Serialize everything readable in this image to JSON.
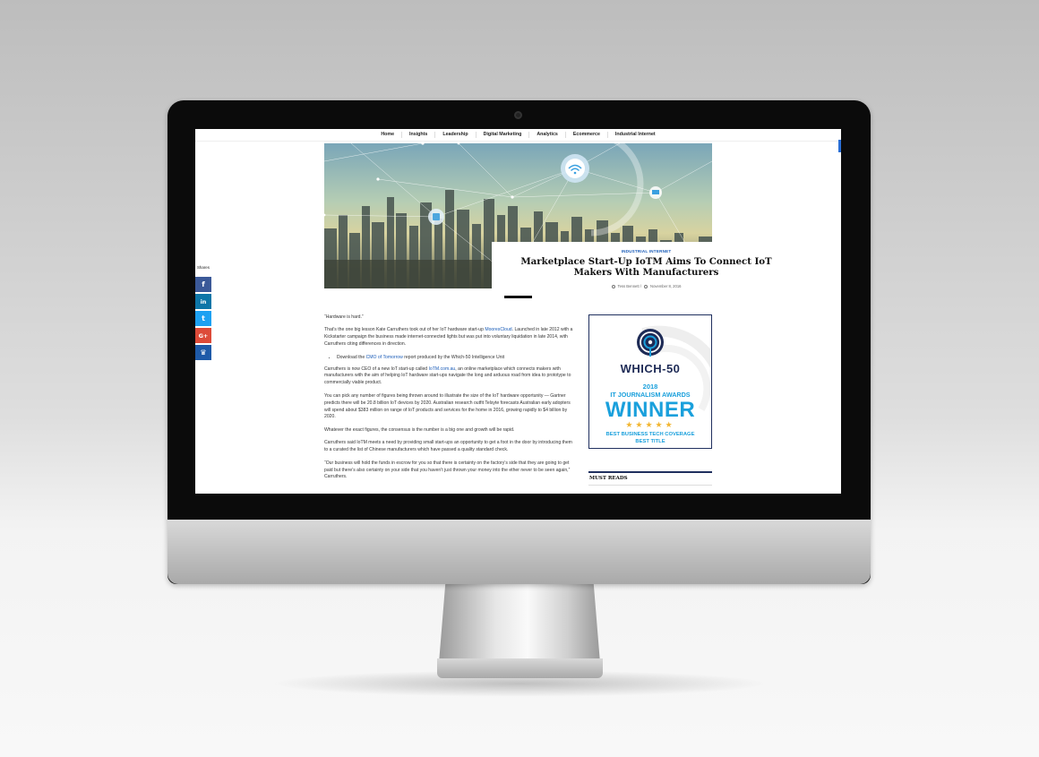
{
  "nav": {
    "items": [
      "Home",
      "Insights",
      "Leadership",
      "Digital Marketing",
      "Analytics",
      "Ecommerce",
      "Industrial Internet"
    ]
  },
  "article": {
    "category": "INDUSTRIAL INTERNET",
    "title": "Marketplace Start-Up IoTM Aims To Connect IoT Makers With Manufacturers",
    "author": "Tess Bennett /",
    "date": "November 8, 2016",
    "p1": "“Hardware is hard.”",
    "p2_before": "That’s the one big lesson Kate Carruthers took out of her IoT hardware start-up ",
    "p2_link": "MooresCloud",
    "p2_after": ". Launched in late 2012 with a Kickstarter campaign the business made internet-connected lights but was put into voluntary liquidation in late 2014, with Carruthers citing differences in direction.",
    "bullet_before": "Download the ",
    "bullet_link": "CMO of Tomorrow",
    "bullet_after": " report produced by the Which-50 Intelligence Unit",
    "p3_before": "Carruthers is now CEO of a new IoT start-up called ",
    "p3_link": "IoTM.com.au",
    "p3_after": ", an online marketplace which connects makers with manufacturers with the aim of helping IoT hardware start-ups navigate the long and arduous road from idea to prototype to commercially viable product.",
    "p4": "You can pick any number of figures being thrown around to illustrate the size of the IoT hardware opportunity — Gartner predicts there will be 20.8 billion IoT devices by 2020. Australian research outfit Telsyte forecasts Australian early adopters will spend about $383 million on range of IoT products and services for the home in 2016, growing rapidly to $4 billion by 2020.",
    "p5": "Whatever the exact figures, the consensus is the number is a big one and growth will be rapid.",
    "p6": "Carruthers said IoTM meets a need by providing small start-ups an opportunity to get a foot in the door by introducing them to a curated the list of Chinese manufacturers which have passed a quality standard check.",
    "p7": "“Our business will hold the funds in escrow for you so that there is certainty on the factory’s side that they are going to get paid but there’s also certainty on your side that you haven’t just thrown your money into the ether never to be seen again,” Carruthers."
  },
  "share": {
    "label": "Shares",
    "buttons": [
      {
        "glyph": "f",
        "icon": "facebook-icon",
        "color": "#3b5998"
      },
      {
        "glyph": "in",
        "icon": "linkedin-icon",
        "color": "#0e76a8"
      },
      {
        "glyph": "t",
        "icon": "twitter-icon",
        "color": "#1da1f2"
      },
      {
        "glyph": "G+",
        "icon": "googleplus-icon",
        "color": "#dd4b39"
      },
      {
        "glyph": "♛",
        "icon": "crown-icon",
        "color": "#1e5aa8"
      }
    ]
  },
  "award": {
    "brand": "WHICH-50",
    "year": "2018",
    "line1": "IT JOURNALISM AWARDS",
    "winner": "WINNER",
    "stars": "★★★★★",
    "cat1": "BEST BUSINESS TECH COVERAGE",
    "cat2": "BEST TITLE"
  },
  "sidebar": {
    "must_reads": "MUST READS"
  },
  "colors": {
    "accent": "#1a5cb8",
    "award_blue": "#1aa0dc",
    "award_navy": "#1e2b56"
  }
}
